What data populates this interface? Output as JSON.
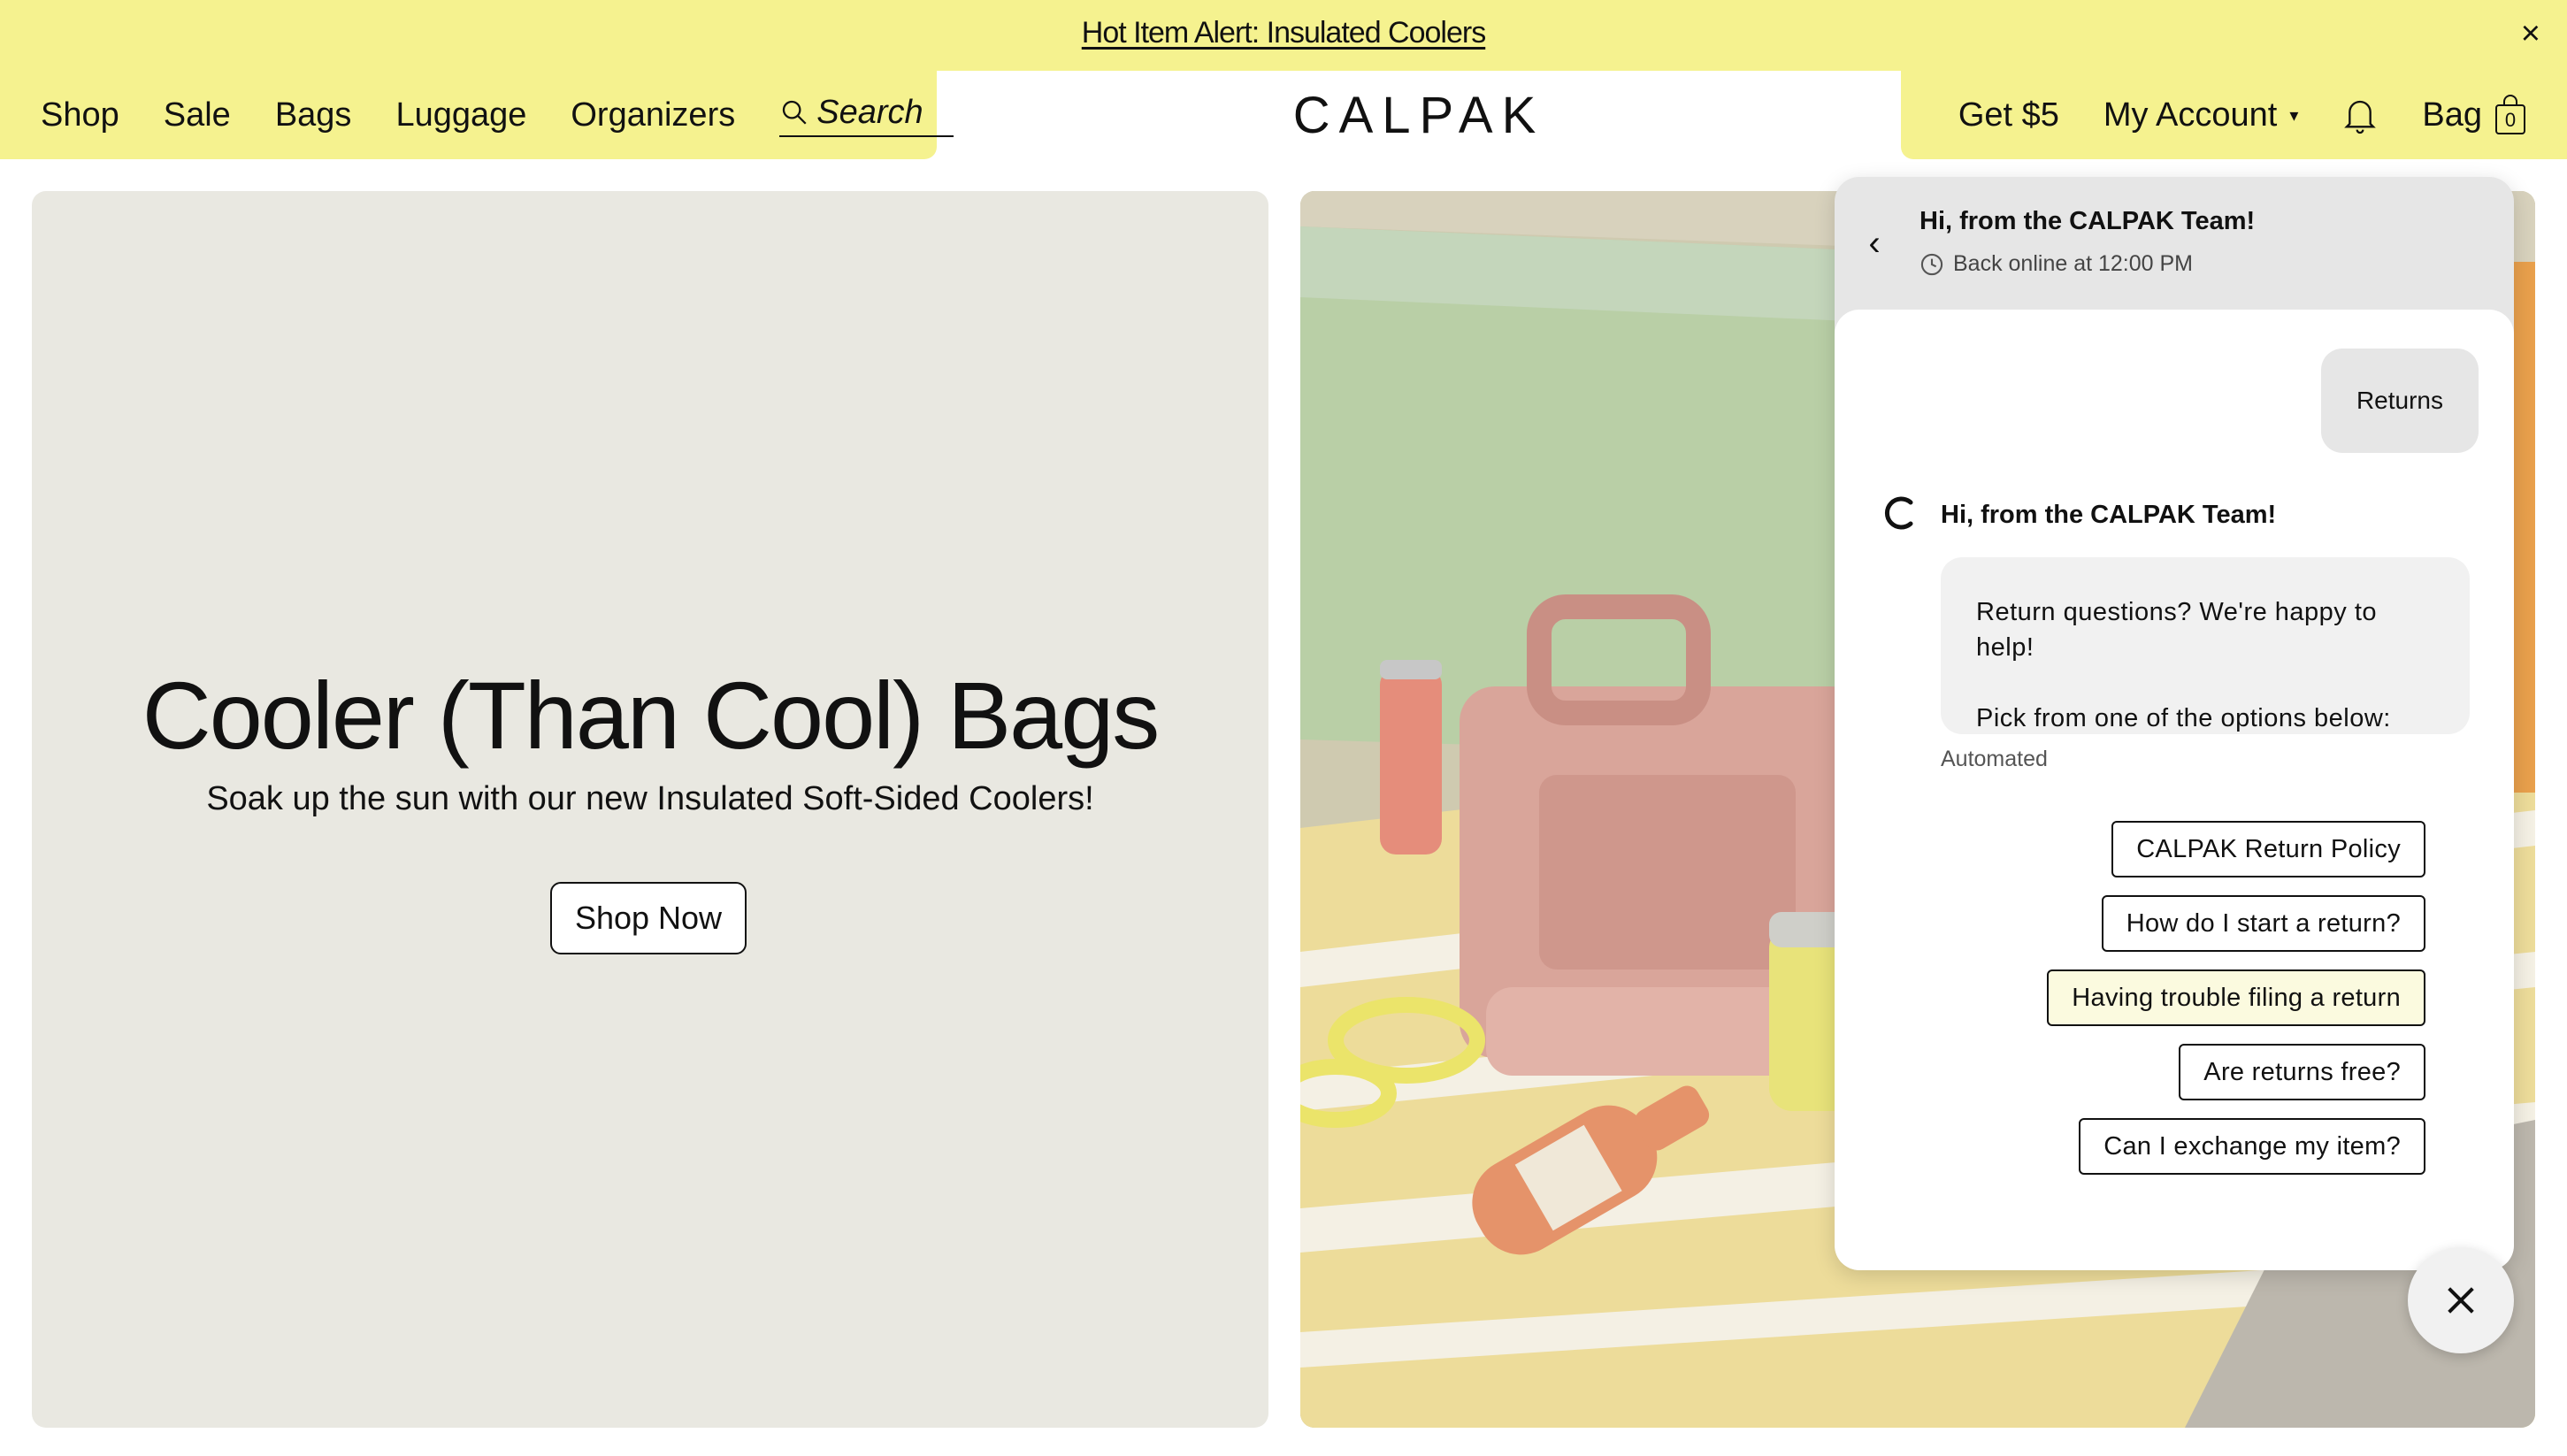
{
  "announcement": {
    "text": "Hot Item Alert: Insulated Coolers",
    "close": "×"
  },
  "nav": {
    "left": [
      "Shop",
      "Sale",
      "Bags",
      "Luggage",
      "Organizers"
    ],
    "search_label": "Search",
    "logo": "CALPAK",
    "get_five": "Get $5",
    "account": "My Account",
    "account_caret": "▾",
    "bag": "Bag",
    "bag_count": "0"
  },
  "hero": {
    "title": "Cooler (Than Cool) Bags",
    "subtitle": "Soak up the sun with our new Insulated Soft-Sided Coolers!",
    "cta": "Shop Now"
  },
  "chat": {
    "back": "‹",
    "title": "Hi, from the CALPAK Team!",
    "status": "Back online at 12:00 PM",
    "user_message": "Returns",
    "agent_name": "Hi, from the CALPAK Team!",
    "agent_lines": [
      "Return questions? We're happy to help!",
      "Pick from one of the options below:"
    ],
    "automated": "Automated",
    "options": [
      "CALPAK Return Policy",
      "How do I start a return?",
      "Having trouble filing a return",
      "Are returns free?",
      "Can I exchange my item?"
    ],
    "highlighted_option": "Having trouble filing a return"
  },
  "colors": {
    "header_yellow": "#f5f28f",
    "hero_gray": "#e9e8e1",
    "option_highlight": "#fbfadf"
  },
  "icons": [
    "search-icon",
    "bell-icon",
    "bag-icon",
    "clock-icon",
    "back-icon",
    "close-icon",
    "calpak-c-icon"
  ]
}
